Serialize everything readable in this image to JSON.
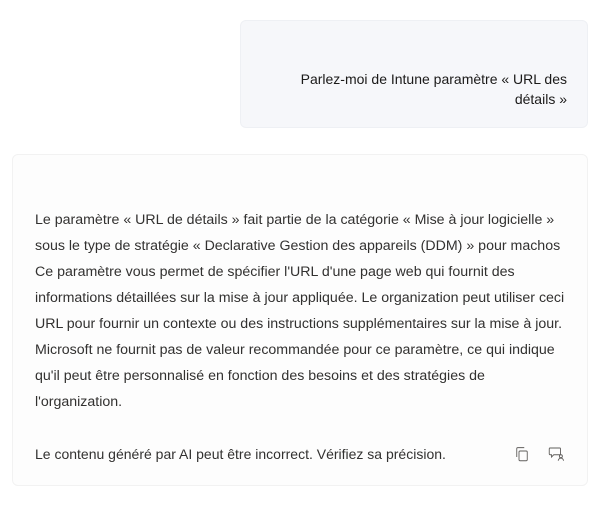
{
  "user_message": {
    "text": "Parlez-moi de Intune paramètre « URL des détails »"
  },
  "assistant_message": {
    "body": "Le paramètre « URL de détails » fait partie de la catégorie « Mise à jour logicielle » sous le type de stratégie « Declarative Gestion des appareils (DDM) » pour machos Ce paramètre vous permet de spécifier l'URL d'une page web qui fournit des informations détaillées sur la mise à jour appliquée. Le organization peut utiliser ceci URL pour fournir un contexte ou des instructions supplémentaires sur la mise à jour. Microsoft ne fournit pas de valeur recommandée pour ce paramètre, ce qui indique qu'il peut être personnalisé en fonction des besoins et des stratégies de l'organization.",
    "disclaimer": "Le contenu généré par AI peut être incorrect. Vérifiez sa précision."
  },
  "icons": {
    "copy": "copy-icon",
    "feedback": "feedback-person-icon"
  }
}
